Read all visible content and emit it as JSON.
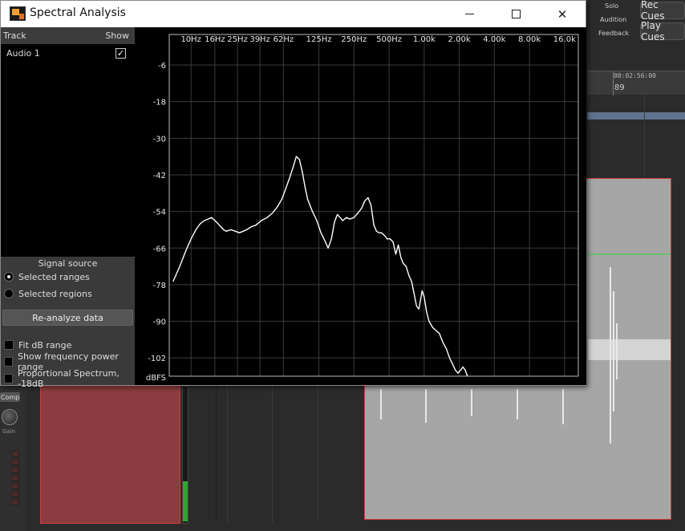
{
  "window": {
    "title": "Spectral Analysis",
    "minimize_icon": "minimize-icon",
    "maximize_icon": "maximize-icon",
    "close_icon": "close-icon",
    "close_glyph": "✕"
  },
  "track_list": {
    "header_track": "Track",
    "header_show": "Show",
    "tracks": [
      {
        "name": "Audio 1",
        "shown": true,
        "check_glyph": "✓"
      }
    ]
  },
  "signal_source": {
    "label": "Signal source",
    "options": [
      {
        "label": "Selected ranges",
        "selected": true
      },
      {
        "label": "Selected regions",
        "selected": false
      }
    ],
    "reanalyze_label": "Re-analyze data"
  },
  "options": [
    {
      "label": "Fit dB range",
      "checked": false
    },
    {
      "label": "Show frequency power range",
      "checked": false
    },
    {
      "label": "Proportional Spectrum, -18dB",
      "checked": false
    }
  ],
  "chart_data": {
    "type": "line",
    "x_scale": "log",
    "x_ticks": [
      {
        "hz": 10,
        "label": "10Hz"
      },
      {
        "hz": 16,
        "label": "16Hz"
      },
      {
        "hz": 25,
        "label": "25Hz"
      },
      {
        "hz": 39,
        "label": "39Hz"
      },
      {
        "hz": 62,
        "label": "62Hz"
      },
      {
        "hz": 125,
        "label": "125Hz"
      },
      {
        "hz": 250,
        "label": "250Hz"
      },
      {
        "hz": 500,
        "label": "500Hz"
      },
      {
        "hz": 1000,
        "label": "1.00k"
      },
      {
        "hz": 2000,
        "label": "2.00k"
      },
      {
        "hz": 4000,
        "label": "4.00k"
      },
      {
        "hz": 8000,
        "label": "8.00k"
      },
      {
        "hz": 16000,
        "label": "16.0k"
      }
    ],
    "xlim": [
      6.5,
      21000
    ],
    "y_ticks": [
      -6,
      -18,
      -30,
      -42,
      -54,
      -66,
      -78,
      -90,
      -102
    ],
    "ylim": [
      -108,
      4
    ],
    "ylabel": "dBFS",
    "grid": true,
    "line_color": "#ffffff",
    "background": "#000000",
    "series": [
      {
        "points": [
          [
            7,
            -77
          ],
          [
            8,
            -72
          ],
          [
            9,
            -67
          ],
          [
            10,
            -63
          ],
          [
            11,
            -60
          ],
          [
            12,
            -58
          ],
          [
            13,
            -57
          ],
          [
            14,
            -56.5
          ],
          [
            15,
            -56
          ],
          [
            16,
            -57
          ],
          [
            17,
            -58
          ],
          [
            18,
            -59
          ],
          [
            19,
            -60
          ],
          [
            20,
            -60.5
          ],
          [
            22,
            -60
          ],
          [
            24,
            -60.5
          ],
          [
            26,
            -61
          ],
          [
            28,
            -60.5
          ],
          [
            30,
            -60
          ],
          [
            33,
            -59
          ],
          [
            36,
            -58.5
          ],
          [
            40,
            -57
          ],
          [
            45,
            -56
          ],
          [
            50,
            -54.5
          ],
          [
            55,
            -52.5
          ],
          [
            60,
            -50
          ],
          [
            65,
            -46.5
          ],
          [
            70,
            -43
          ],
          [
            75,
            -39.5
          ],
          [
            80,
            -36
          ],
          [
            85,
            -37
          ],
          [
            90,
            -41
          ],
          [
            95,
            -46
          ],
          [
            100,
            -50
          ],
          [
            110,
            -54
          ],
          [
            120,
            -57
          ],
          [
            130,
            -61
          ],
          [
            140,
            -63.5
          ],
          [
            150,
            -66
          ],
          [
            160,
            -63
          ],
          [
            170,
            -57.5
          ],
          [
            180,
            -55
          ],
          [
            190,
            -56
          ],
          [
            200,
            -57
          ],
          [
            215,
            -56
          ],
          [
            230,
            -56.5
          ],
          [
            250,
            -56
          ],
          [
            270,
            -54.5
          ],
          [
            290,
            -53
          ],
          [
            310,
            -50.5
          ],
          [
            330,
            -49.5
          ],
          [
            350,
            -52
          ],
          [
            370,
            -58.5
          ],
          [
            390,
            -60.5
          ],
          [
            410,
            -61
          ],
          [
            430,
            -61
          ],
          [
            460,
            -62
          ],
          [
            480,
            -63
          ],
          [
            510,
            -63
          ],
          [
            540,
            -64
          ],
          [
            570,
            -68
          ],
          [
            600,
            -65
          ],
          [
            630,
            -69
          ],
          [
            660,
            -71
          ],
          [
            700,
            -72
          ],
          [
            740,
            -75
          ],
          [
            780,
            -77
          ],
          [
            820,
            -81
          ],
          [
            860,
            -85
          ],
          [
            900,
            -86
          ],
          [
            930,
            -83
          ],
          [
            960,
            -80
          ],
          [
            1000,
            -82
          ],
          [
            1050,
            -87
          ],
          [
            1100,
            -90
          ],
          [
            1180,
            -92
          ],
          [
            1260,
            -93
          ],
          [
            1350,
            -94
          ],
          [
            1450,
            -97
          ],
          [
            1550,
            -99
          ],
          [
            1650,
            -102
          ],
          [
            1750,
            -104
          ],
          [
            1850,
            -106
          ],
          [
            1950,
            -107
          ],
          [
            2050,
            -106
          ],
          [
            2150,
            -105
          ],
          [
            2250,
            -106
          ],
          [
            2350,
            -108
          ]
        ]
      }
    ]
  },
  "background_app": {
    "solo_label": "Solo",
    "audition_label": "Audition",
    "feedback_label": "Feedback",
    "rec_cues_label": "Rec Cues",
    "play_cues_label": "Play Cues",
    "timecode": "00:02:56:00",
    "bar_number": "89",
    "comp_label": "Comp",
    "gain_label": "Gain"
  }
}
